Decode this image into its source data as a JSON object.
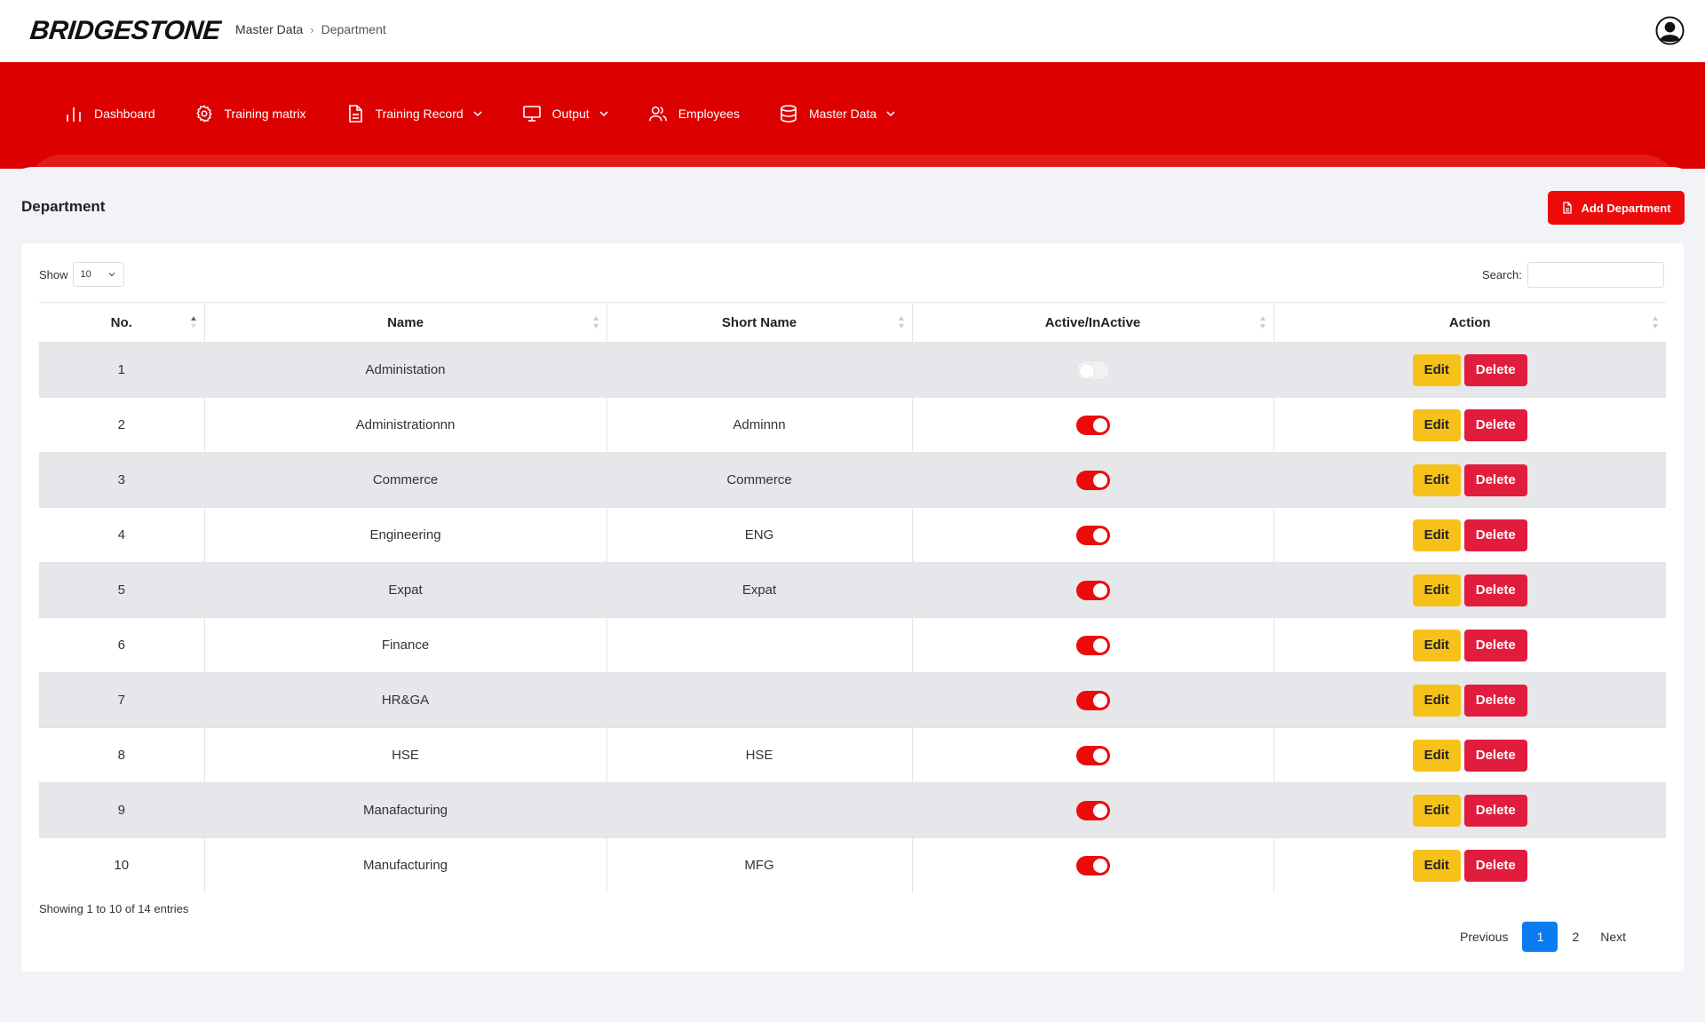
{
  "brand": {
    "logo": "BRIDGESTONE"
  },
  "breadcrumb": {
    "parent": "Master Data",
    "current": "Department"
  },
  "nav": [
    {
      "label": "Dashboard",
      "icon": "bar-chart-icon",
      "dropdown": false
    },
    {
      "label": "Training matrix",
      "icon": "gear-icon",
      "dropdown": false
    },
    {
      "label": "Training Record",
      "icon": "document-icon",
      "dropdown": true
    },
    {
      "label": "Output",
      "icon": "monitor-icon",
      "dropdown": true
    },
    {
      "label": "Employees",
      "icon": "users-icon",
      "dropdown": false
    },
    {
      "label": "Master Data",
      "icon": "database-icon",
      "dropdown": true
    }
  ],
  "page": {
    "title": "Department",
    "add_button": "Add Department"
  },
  "controls": {
    "show_label": "Show",
    "page_size": "10",
    "search_label": "Search:",
    "search_value": ""
  },
  "table": {
    "columns": [
      "No.",
      "Name",
      "Short Name",
      "Active/InActive",
      "Action"
    ],
    "rows": [
      {
        "no": "1",
        "name": "Administation",
        "short": "",
        "active": false
      },
      {
        "no": "2",
        "name": "Administrationnn",
        "short": "Adminnn",
        "active": true
      },
      {
        "no": "3",
        "name": "Commerce",
        "short": "Commerce",
        "active": true
      },
      {
        "no": "4",
        "name": "Engineering",
        "short": "ENG",
        "active": true
      },
      {
        "no": "5",
        "name": "Expat",
        "short": "Expat",
        "active": true
      },
      {
        "no": "6",
        "name": "Finance",
        "short": "",
        "active": true
      },
      {
        "no": "7",
        "name": "HR&GA",
        "short": "",
        "active": true
      },
      {
        "no": "8",
        "name": "HSE",
        "short": "HSE",
        "active": true
      },
      {
        "no": "9",
        "name": "Manafacturing",
        "short": "",
        "active": true
      },
      {
        "no": "10",
        "name": "Manufacturing",
        "short": "MFG",
        "active": true
      }
    ],
    "edit_label": "Edit",
    "delete_label": "Delete"
  },
  "footer": {
    "info": "Showing 1 to 10 of 14 entries",
    "previous": "Previous",
    "pages": [
      "1",
      "2"
    ],
    "next": "Next"
  },
  "colors": {
    "nav_red": "#dc0000",
    "add_red": "#ed0a0a",
    "edit_yellow": "#f6c21a",
    "delete_red": "#e21c3c",
    "page_active": "#0a7cf0"
  }
}
